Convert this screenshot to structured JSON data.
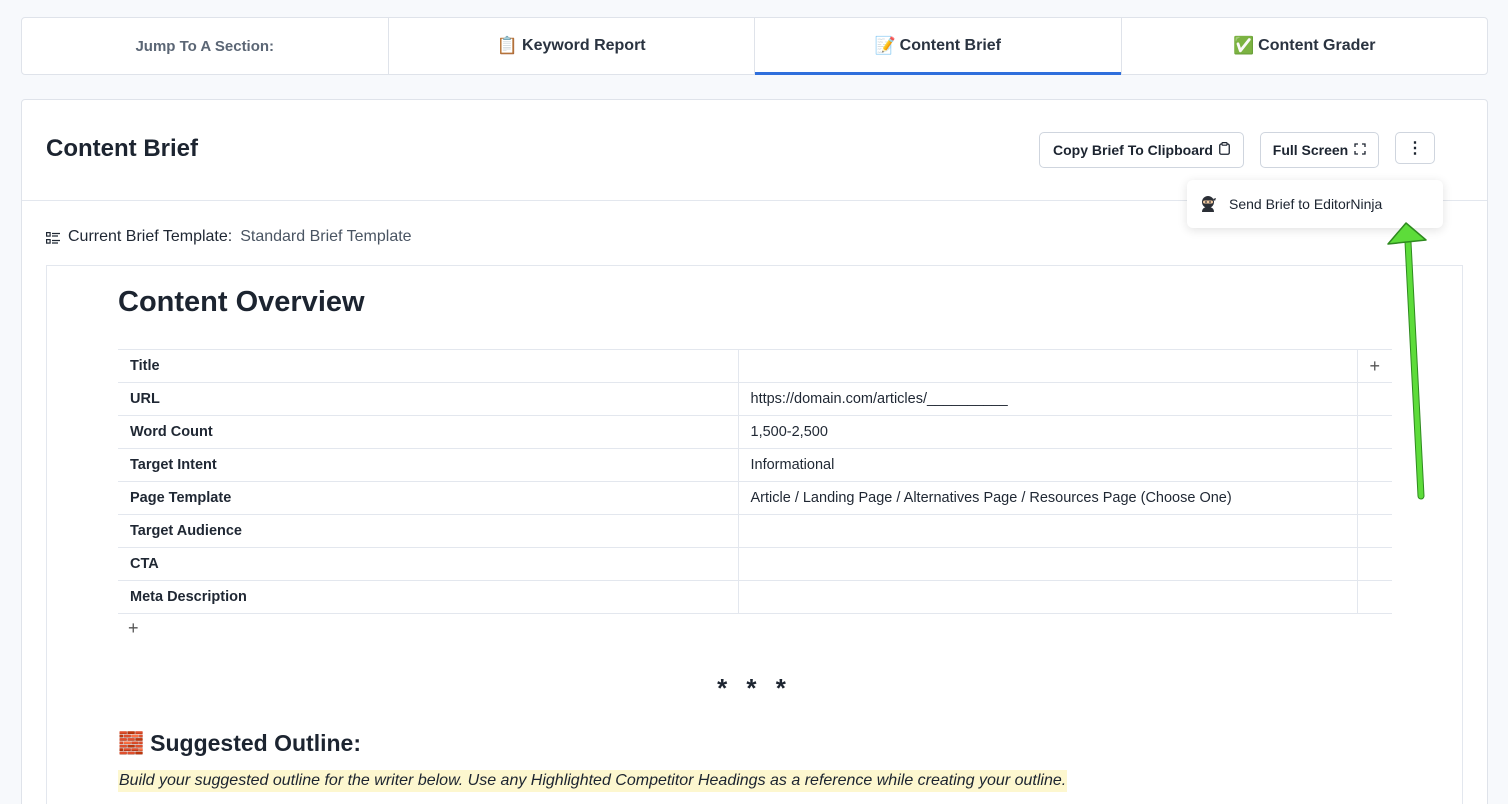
{
  "section_nav": {
    "label": "Jump To A Section:",
    "tabs": [
      {
        "label": "Keyword Report",
        "icon": "📋",
        "active": false
      },
      {
        "label": "Content Brief",
        "icon": "📝",
        "active": true
      },
      {
        "label": "Content Grader",
        "icon": "✅",
        "active": false
      }
    ]
  },
  "card": {
    "title": "Content Brief",
    "copy_button": "Copy Brief To Clipboard",
    "copy_icon": "clipboard-icon",
    "fullscreen_button": "Full Screen",
    "fullscreen_icon": "expand-icon",
    "more_button": "⋮"
  },
  "template": {
    "label": "Current Brief Template:",
    "value": "Standard Brief Template"
  },
  "dropdown": {
    "item": "Send Brief to EditorNinja",
    "icon": "ninja-icon"
  },
  "editor": {
    "heading": "Content Overview",
    "rows": [
      {
        "key": "Title",
        "value": ""
      },
      {
        "key": "URL",
        "value": "https://domain.com/articles/__________"
      },
      {
        "key": "Word Count",
        "value": "1,500-2,500"
      },
      {
        "key": "Target Intent",
        "value": "Informational"
      },
      {
        "key": "Page Template",
        "value": "Article / Landing Page / Alternatives Page / Resources Page (Choose One)"
      },
      {
        "key": "Target Audience",
        "value": ""
      },
      {
        "key": "CTA",
        "value": ""
      },
      {
        "key": "Meta Description",
        "value": ""
      }
    ],
    "add_col": "+",
    "add_row": "+",
    "separator": "* * *",
    "outline_icon": "🧱",
    "outline_heading": "Suggested Outline:",
    "outline_note": "Build your suggested outline for the writer below. Use any Highlighted Competitor Headings as a reference while creating your outline."
  },
  "colors": {
    "accent": "#2f6fdc",
    "highlight": "#fdf7cf",
    "arrow": "#5ddc3a"
  }
}
